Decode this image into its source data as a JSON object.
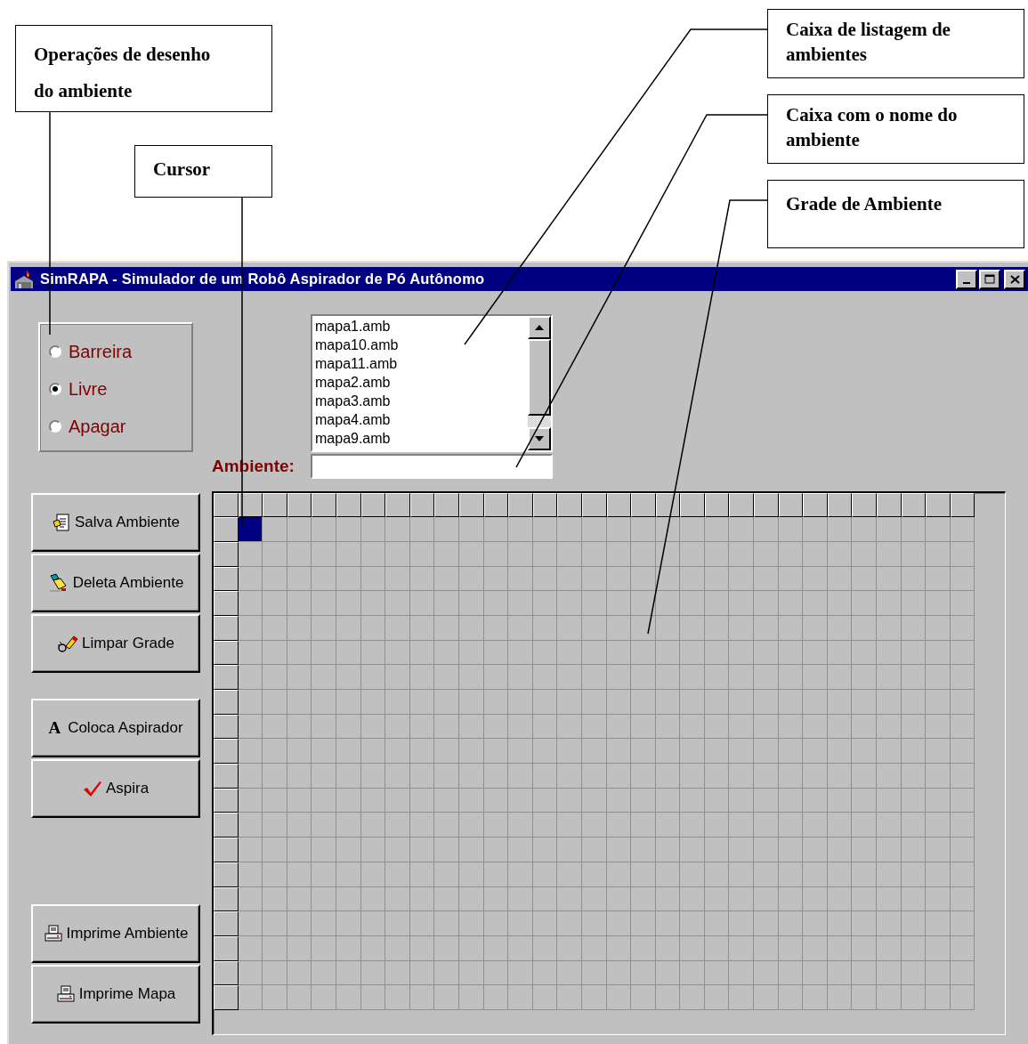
{
  "annotations": [
    {
      "lines": [
        "Operações de desenho",
        "do ambiente"
      ]
    },
    {
      "lines": [
        "Cursor"
      ]
    },
    {
      "lines": [
        "Caixa de listagem de",
        "ambientes"
      ]
    },
    {
      "lines": [
        "Caixa com o nome do",
        "ambiente"
      ]
    },
    {
      "lines": [
        "Grade de Ambiente"
      ]
    }
  ],
  "window": {
    "title": "SimRAPA -  Simulador de um Robô Aspirador de Pó Autônomo"
  },
  "drawing_modes": [
    {
      "label": "Barreira",
      "selected": false
    },
    {
      "label": "Livre",
      "selected": true
    },
    {
      "label": "Apagar",
      "selected": false
    }
  ],
  "environment_list": {
    "items": [
      "mapa1.amb",
      "mapa10.amb",
      "mapa11.amb",
      "mapa2.amb",
      "mapa3.amb",
      "mapa4.amb",
      "mapa9.amb"
    ]
  },
  "environment_name": {
    "label": "Ambiente:"
  },
  "button_groups": [
    [
      {
        "label": "Salva Ambiente",
        "kind": "save"
      },
      {
        "label": "Deleta  Ambiente",
        "kind": "delete"
      },
      {
        "label": "Limpar Grade",
        "kind": "clear"
      }
    ],
    [
      {
        "label": "Coloca Aspirador",
        "kind": "letter",
        "glyph": "A"
      },
      {
        "label": "Aspira",
        "kind": "check"
      }
    ],
    [
      {
        "label": "Imprime Ambiente",
        "kind": "print"
      },
      {
        "label": "Imprime Mapa",
        "kind": "print"
      }
    ]
  ],
  "grid": {
    "rows": [
      {
        "cursor": [
          true,
          false,
          false,
          false,
          false,
          false,
          false,
          false,
          false,
          false,
          false,
          false,
          false,
          false,
          false,
          false,
          false,
          false,
          false,
          false,
          false,
          false,
          false,
          false,
          false,
          false,
          false,
          false,
          false,
          false
        ]
      },
      {
        "cursor": [
          false,
          false,
          false,
          false,
          false,
          false,
          false,
          false,
          false,
          false,
          false,
          false,
          false,
          false,
          false,
          false,
          false,
          false,
          false,
          false,
          false,
          false,
          false,
          false,
          false,
          false,
          false,
          false,
          false,
          false
        ]
      },
      {
        "cursor": [
          false,
          false,
          false,
          false,
          false,
          false,
          false,
          false,
          false,
          false,
          false,
          false,
          false,
          false,
          false,
          false,
          false,
          false,
          false,
          false,
          false,
          false,
          false,
          false,
          false,
          false,
          false,
          false,
          false,
          false
        ]
      },
      {
        "cursor": [
          false,
          false,
          false,
          false,
          false,
          false,
          false,
          false,
          false,
          false,
          false,
          false,
          false,
          false,
          false,
          false,
          false,
          false,
          false,
          false,
          false,
          false,
          false,
          false,
          false,
          false,
          false,
          false,
          false,
          false
        ]
      },
      {
        "cursor": [
          false,
          false,
          false,
          false,
          false,
          false,
          false,
          false,
          false,
          false,
          false,
          false,
          false,
          false,
          false,
          false,
          false,
          false,
          false,
          false,
          false,
          false,
          false,
          false,
          false,
          false,
          false,
          false,
          false,
          false
        ]
      },
      {
        "cursor": [
          false,
          false,
          false,
          false,
          false,
          false,
          false,
          false,
          false,
          false,
          false,
          false,
          false,
          false,
          false,
          false,
          false,
          false,
          false,
          false,
          false,
          false,
          false,
          false,
          false,
          false,
          false,
          false,
          false,
          false
        ]
      },
      {
        "cursor": [
          false,
          false,
          false,
          false,
          false,
          false,
          false,
          false,
          false,
          false,
          false,
          false,
          false,
          false,
          false,
          false,
          false,
          false,
          false,
          false,
          false,
          false,
          false,
          false,
          false,
          false,
          false,
          false,
          false,
          false
        ]
      },
      {
        "cursor": [
          false,
          false,
          false,
          false,
          false,
          false,
          false,
          false,
          false,
          false,
          false,
          false,
          false,
          false,
          false,
          false,
          false,
          false,
          false,
          false,
          false,
          false,
          false,
          false,
          false,
          false,
          false,
          false,
          false,
          false
        ]
      },
      {
        "cursor": [
          false,
          false,
          false,
          false,
          false,
          false,
          false,
          false,
          false,
          false,
          false,
          false,
          false,
          false,
          false,
          false,
          false,
          false,
          false,
          false,
          false,
          false,
          false,
          false,
          false,
          false,
          false,
          false,
          false,
          false
        ]
      },
      {
        "cursor": [
          false,
          false,
          false,
          false,
          false,
          false,
          false,
          false,
          false,
          false,
          false,
          false,
          false,
          false,
          false,
          false,
          false,
          false,
          false,
          false,
          false,
          false,
          false,
          false,
          false,
          false,
          false,
          false,
          false,
          false
        ]
      },
      {
        "cursor": [
          false,
          false,
          false,
          false,
          false,
          false,
          false,
          false,
          false,
          false,
          false,
          false,
          false,
          false,
          false,
          false,
          false,
          false,
          false,
          false,
          false,
          false,
          false,
          false,
          false,
          false,
          false,
          false,
          false,
          false
        ]
      },
      {
        "cursor": [
          false,
          false,
          false,
          false,
          false,
          false,
          false,
          false,
          false,
          false,
          false,
          false,
          false,
          false,
          false,
          false,
          false,
          false,
          false,
          false,
          false,
          false,
          false,
          false,
          false,
          false,
          false,
          false,
          false,
          false
        ]
      },
      {
        "cursor": [
          false,
          false,
          false,
          false,
          false,
          false,
          false,
          false,
          false,
          false,
          false,
          false,
          false,
          false,
          false,
          false,
          false,
          false,
          false,
          false,
          false,
          false,
          false,
          false,
          false,
          false,
          false,
          false,
          false,
          false
        ]
      },
      {
        "cursor": [
          false,
          false,
          false,
          false,
          false,
          false,
          false,
          false,
          false,
          false,
          false,
          false,
          false,
          false,
          false,
          false,
          false,
          false,
          false,
          false,
          false,
          false,
          false,
          false,
          false,
          false,
          false,
          false,
          false,
          false
        ]
      },
      {
        "cursor": [
          false,
          false,
          false,
          false,
          false,
          false,
          false,
          false,
          false,
          false,
          false,
          false,
          false,
          false,
          false,
          false,
          false,
          false,
          false,
          false,
          false,
          false,
          false,
          false,
          false,
          false,
          false,
          false,
          false,
          false
        ]
      },
      {
        "cursor": [
          false,
          false,
          false,
          false,
          false,
          false,
          false,
          false,
          false,
          false,
          false,
          false,
          false,
          false,
          false,
          false,
          false,
          false,
          false,
          false,
          false,
          false,
          false,
          false,
          false,
          false,
          false,
          false,
          false,
          false
        ]
      },
      {
        "cursor": [
          false,
          false,
          false,
          false,
          false,
          false,
          false,
          false,
          false,
          false,
          false,
          false,
          false,
          false,
          false,
          false,
          false,
          false,
          false,
          false,
          false,
          false,
          false,
          false,
          false,
          false,
          false,
          false,
          false,
          false
        ]
      },
      {
        "cursor": [
          false,
          false,
          false,
          false,
          false,
          false,
          false,
          false,
          false,
          false,
          false,
          false,
          false,
          false,
          false,
          false,
          false,
          false,
          false,
          false,
          false,
          false,
          false,
          false,
          false,
          false,
          false,
          false,
          false,
          false
        ]
      },
      {
        "cursor": [
          false,
          false,
          false,
          false,
          false,
          false,
          false,
          false,
          false,
          false,
          false,
          false,
          false,
          false,
          false,
          false,
          false,
          false,
          false,
          false,
          false,
          false,
          false,
          false,
          false,
          false,
          false,
          false,
          false,
          false
        ]
      },
      {
        "cursor": [
          false,
          false,
          false,
          false,
          false,
          false,
          false,
          false,
          false,
          false,
          false,
          false,
          false,
          false,
          false,
          false,
          false,
          false,
          false,
          false,
          false,
          false,
          false,
          false,
          false,
          false,
          false,
          false,
          false,
          false
        ]
      }
    ]
  }
}
